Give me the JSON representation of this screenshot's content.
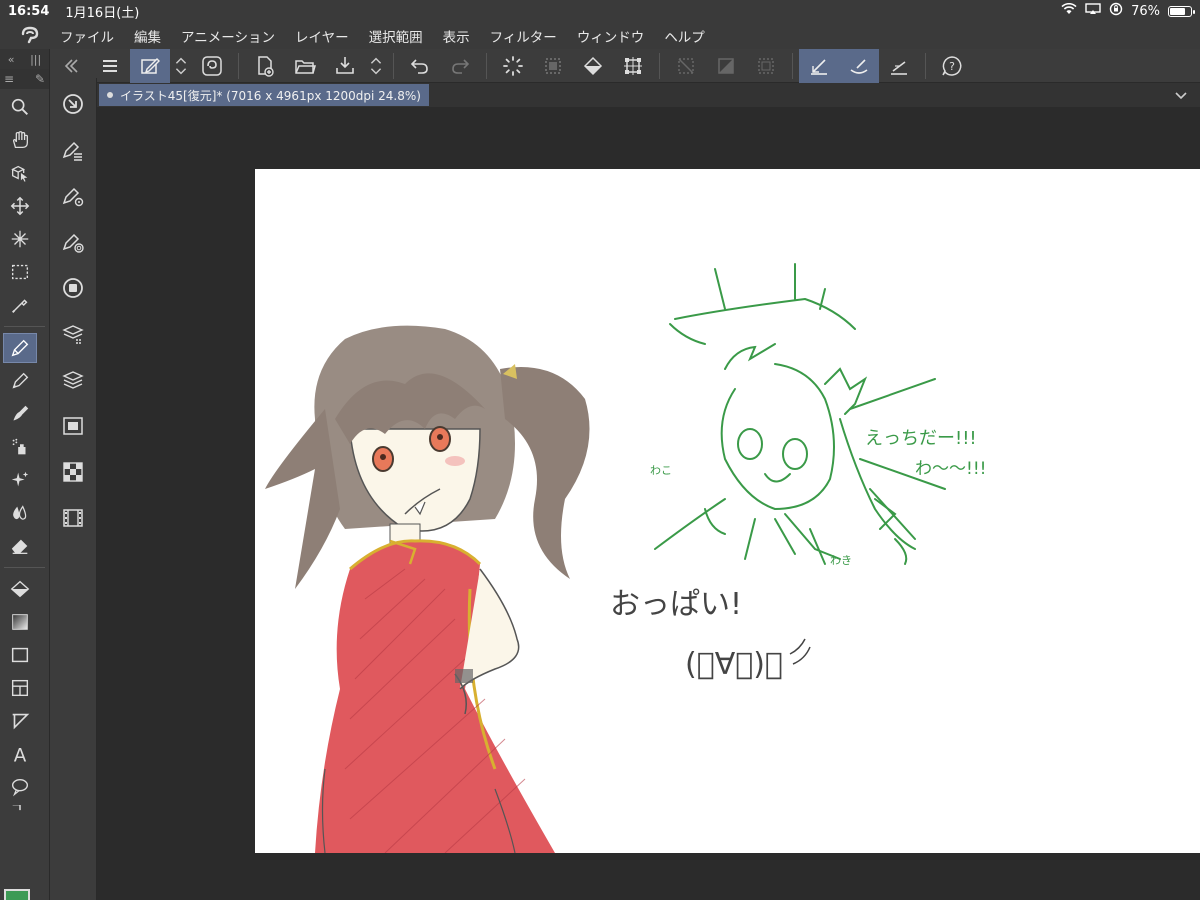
{
  "status": {
    "time": "16:54",
    "date": "1月16日(土)",
    "battery_label": "76%",
    "battery_level": 0.76,
    "icons": [
      "wifi-icon",
      "screen-mirror-icon",
      "orientation-lock-icon",
      "battery-icon"
    ]
  },
  "menubar": {
    "items": [
      "ファイル",
      "編集",
      "アニメーション",
      "レイヤー",
      "選択範囲",
      "表示",
      "フィルター",
      "ウィンドウ",
      "ヘルプ"
    ]
  },
  "document": {
    "tab_label": "イラスト45[復元]* (7016 x 4961px 1200dpi 24.8%)"
  },
  "canvas_text": {
    "line1": "おっぱい!",
    "line2": "(ﾟ∀ﾟ)。",
    "green1": "えっちだー!!!",
    "green2": "わ〜〜!!!",
    "green3": "わこ",
    "green4": "わき"
  },
  "colors": {
    "main_color": "#3c9a55",
    "sub_color": "#e38ee8",
    "accent": "#5a6a8a",
    "sketch_green": "#3a9a48",
    "dress_red": "#e0595e",
    "hair_brown": "#8a7a70"
  }
}
